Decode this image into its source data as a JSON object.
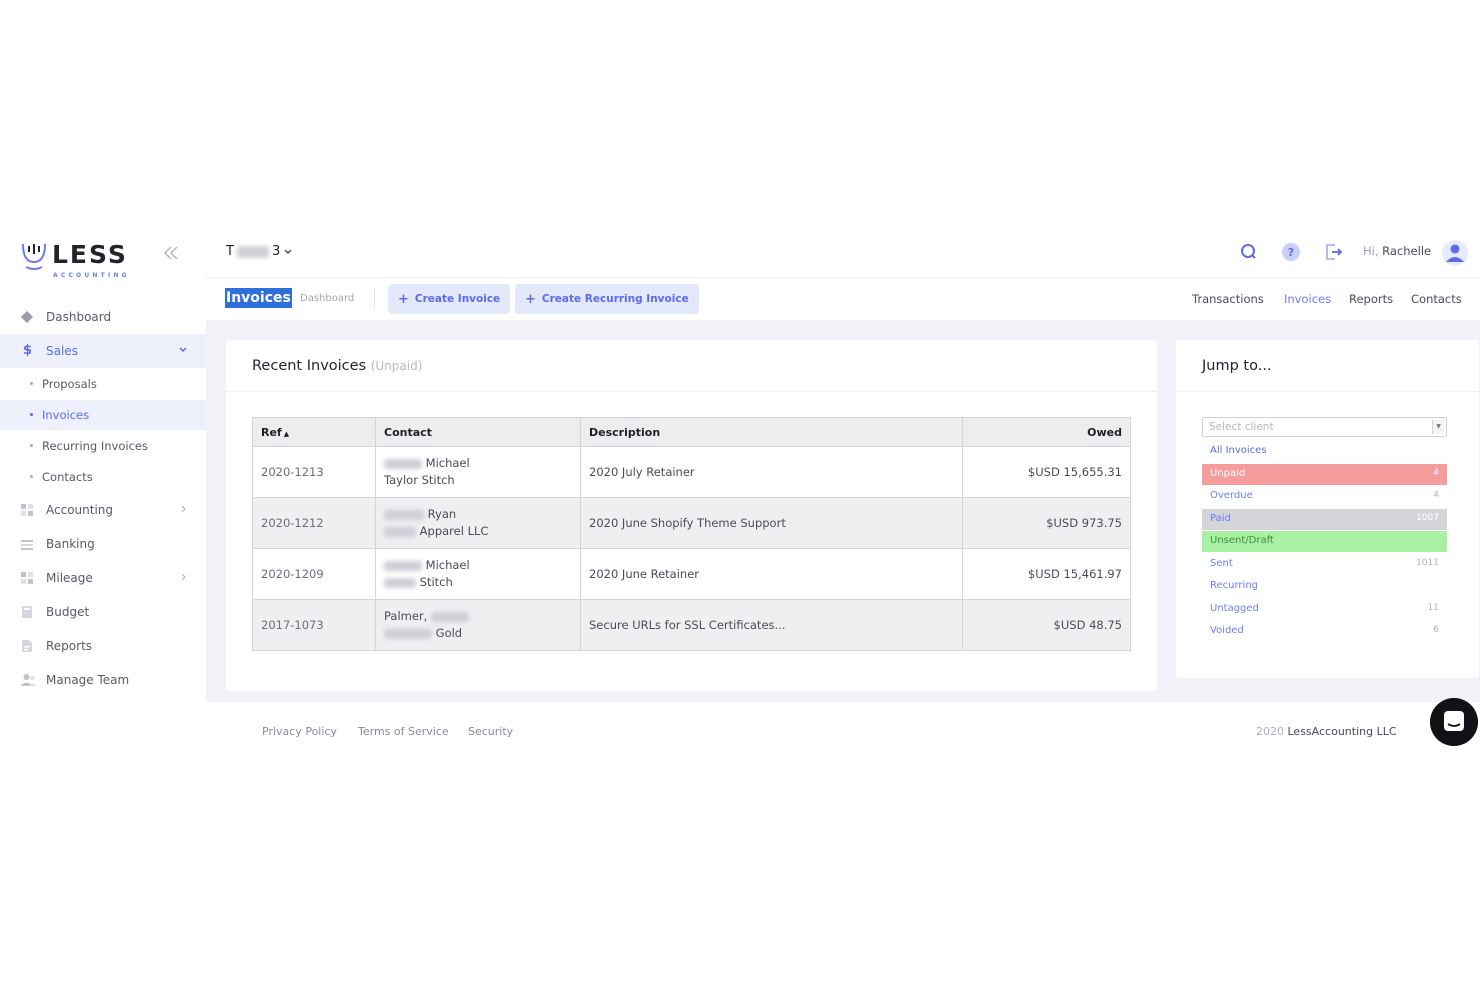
{
  "app": {
    "brand": "LESS",
    "brand_sub": "ACCOUNTING"
  },
  "colors": {
    "accent": "#5b6bea",
    "unpaid": "#f59c9c",
    "paid": "#d4d4d9",
    "unsent": "#a8f0a2",
    "highlight": "#2f6fdc"
  },
  "sidebar": {
    "items": [
      {
        "label": "Dashboard",
        "icon": "diamond-icon"
      },
      {
        "label": "Sales",
        "icon": "dollar-icon",
        "expanded": true,
        "active": true
      },
      {
        "label": "Accounting",
        "icon": "grid-icon"
      },
      {
        "label": "Banking",
        "icon": "bank-icon"
      },
      {
        "label": "Mileage",
        "icon": "grid-icon"
      },
      {
        "label": "Budget",
        "icon": "calculator-icon"
      },
      {
        "label": "Reports",
        "icon": "report-icon"
      },
      {
        "label": "Manage Team",
        "icon": "team-icon"
      }
    ],
    "sales_sub": [
      {
        "label": "Proposals"
      },
      {
        "label": "Invoices",
        "active": true
      },
      {
        "label": "Recurring Invoices"
      },
      {
        "label": "Contacts"
      }
    ]
  },
  "topbar": {
    "company_prefix": "T",
    "company_suffix": "3",
    "greeting_hi": "Hi,",
    "greeting_name": "Rachelle"
  },
  "subbar": {
    "page_tag": "Invoices",
    "dashboard_link": "Dashboard",
    "create_invoice": "Create Invoice",
    "create_recurring": "Create Recurring Invoice",
    "nav": [
      {
        "label": "Transactions"
      },
      {
        "label": "Invoices",
        "active": true
      },
      {
        "label": "Reports"
      },
      {
        "label": "Contacts"
      }
    ]
  },
  "recent": {
    "title": "Recent Invoices",
    "title_filter": "(Unpaid)",
    "columns": {
      "ref": "Ref",
      "contact": "Contact",
      "description": "Description",
      "owed": "Owed"
    },
    "rows": [
      {
        "ref": "2020-1213",
        "contact_l1": "Michael",
        "contact_l2": "Taylor Stitch",
        "description": "2020 July Retainer",
        "owed": "$USD 15,655.31"
      },
      {
        "ref": "2020-1212",
        "contact_l1": "Ryan",
        "contact_l2": "Apparel LLC",
        "description": "2020 June Shopify Theme Support",
        "owed": "$USD 973.75"
      },
      {
        "ref": "2020-1209",
        "contact_l1": "Michael",
        "contact_l2": "Stitch",
        "description": "2020 June Retainer",
        "owed": "$USD 15,461.97"
      },
      {
        "ref": "2017-1073",
        "contact_l1": "Palmer,",
        "contact_l2": "Gold",
        "description": "Secure URLs for SSL Certificates...",
        "owed": "$USD 48.75"
      }
    ]
  },
  "jump": {
    "title": "Jump to...",
    "select_placeholder": "Select client",
    "filters": [
      {
        "name": "All Invoices",
        "count": ""
      },
      {
        "name": "Unpaid",
        "count": "4"
      },
      {
        "name": "Overdue",
        "count": "4"
      },
      {
        "name": "Paid",
        "count": "1007"
      },
      {
        "name": "Unsent/Draft",
        "count": ""
      },
      {
        "name": "Sent",
        "count": "1011"
      },
      {
        "name": "Recurring",
        "count": ""
      },
      {
        "name": "Untagged",
        "count": "11"
      },
      {
        "name": "Voided",
        "count": "6"
      }
    ]
  },
  "footer": {
    "links": [
      "Privacy Policy",
      "Terms of Service",
      "Security"
    ],
    "year": "2020",
    "company": "LessAccounting LLC"
  }
}
